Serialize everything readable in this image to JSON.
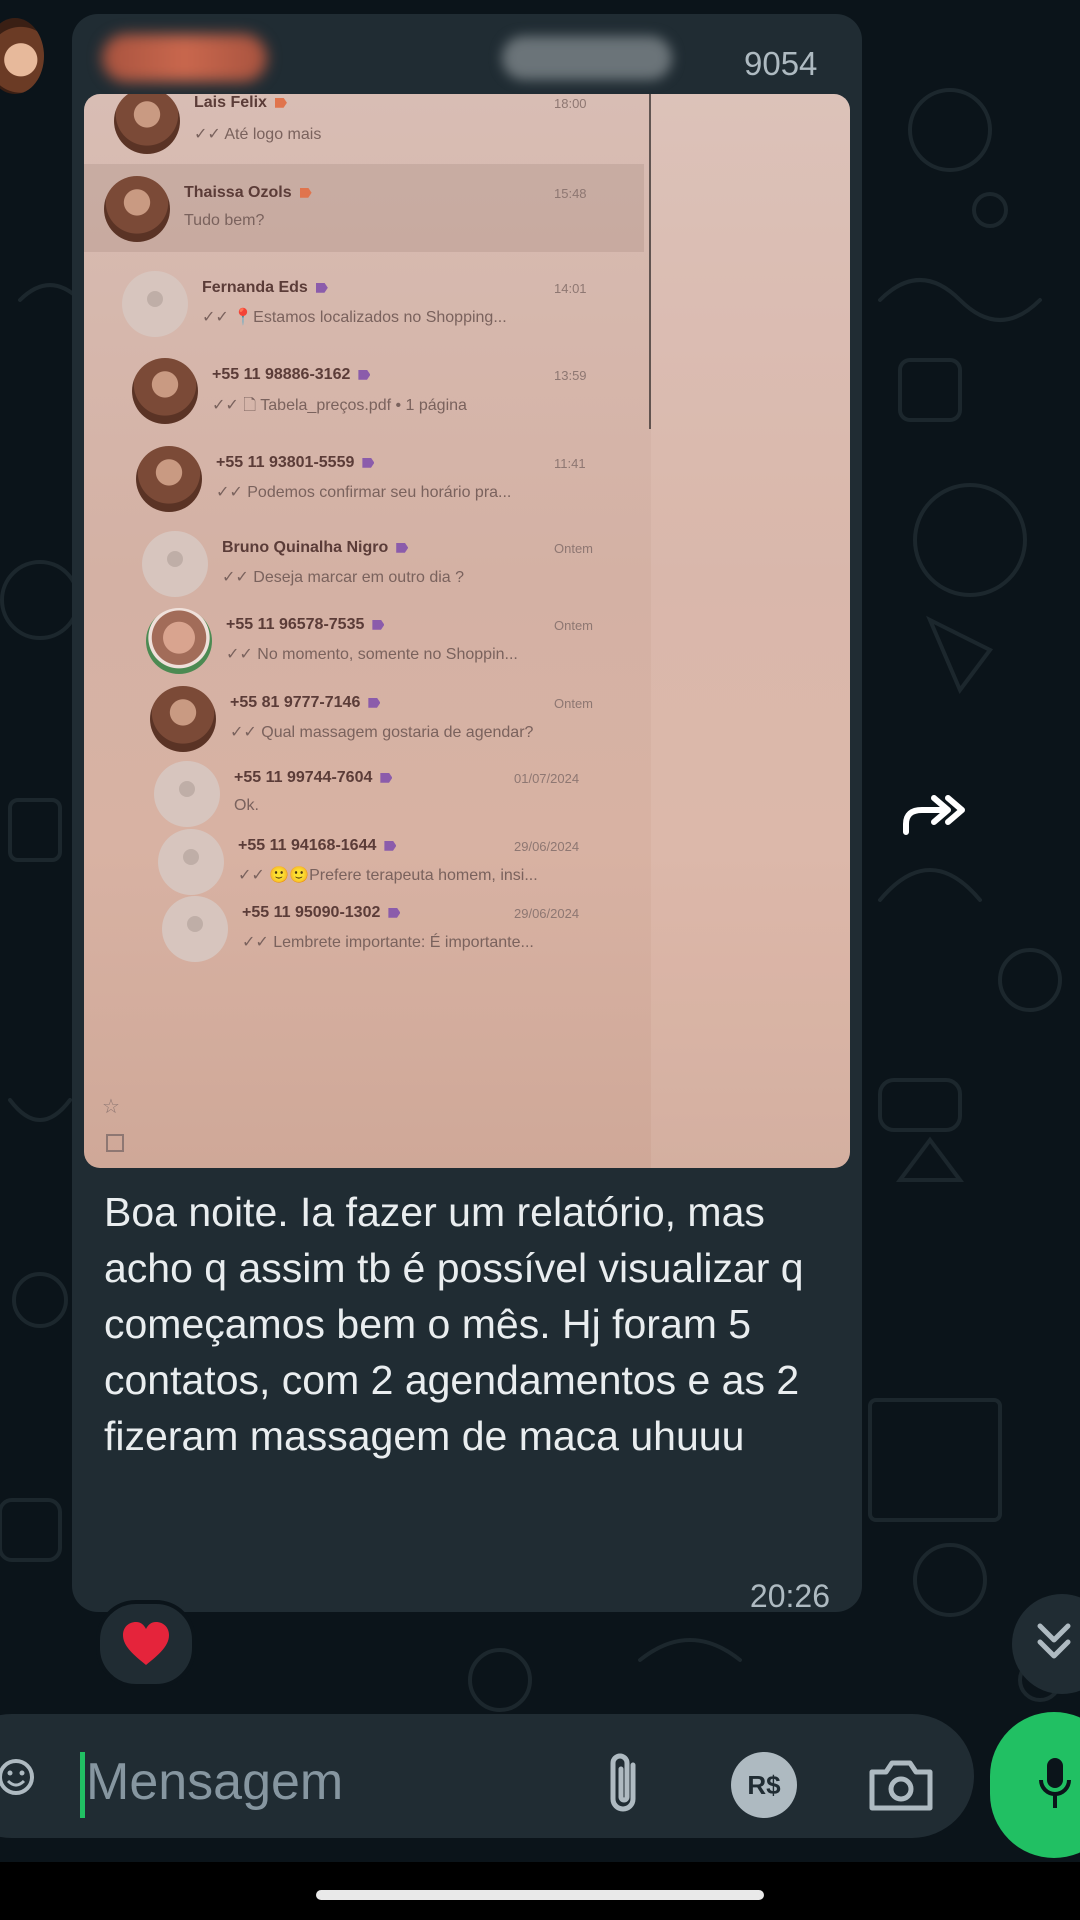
{
  "message": {
    "sender_phone_suffix": "9054",
    "caption": "Boa noite. Ia fazer um relatório, mas acho q assim tb é possível visualizar q começamos bem o mês.  Hj foram  5 contatos, com 2 agendamentos e as 2 fizeram massagem de maca uhuuu",
    "time": "20:26",
    "reaction": "❤️"
  },
  "photo": {
    "chats": [
      {
        "name": "Lais Felix",
        "time": "18:00",
        "preview": "✓✓ Até logo mais",
        "tag_color": "#e0744d",
        "avatar": "photo"
      },
      {
        "name": "Thaissa Ozols",
        "time": "15:48",
        "preview": "Tudo bem?",
        "tag_color": "#e0744d",
        "avatar": "photo",
        "highlighted": true
      },
      {
        "name": "Fernanda Eds",
        "time": "14:01",
        "preview": "✓✓ 📍Estamos localizados no Shopping...",
        "tag_color": "#8b5cab",
        "avatar": "blank"
      },
      {
        "name": "+55 11 98886-3162",
        "time": "13:59",
        "preview": "✓✓ 🗋 Tabela_preços.pdf • 1 página",
        "tag_color": "#8b5cab",
        "avatar": "photo"
      },
      {
        "name": "+55 11 93801-5559",
        "time": "11:41",
        "preview": "✓✓ Podemos confirmar seu horário pra...",
        "tag_color": "#8b5cab",
        "avatar": "photo"
      },
      {
        "name": "Bruno Quinalha Nigro",
        "time": "Ontem",
        "preview": "✓✓ Deseja marcar em outro dia ?",
        "tag_color": "#8b5cab",
        "avatar": "blank"
      },
      {
        "name": "+55 11 96578-7535",
        "time": "Ontem",
        "preview": "✓✓ No momento, somente no Shoppin...",
        "tag_color": "#8b5cab",
        "avatar": "ring"
      },
      {
        "name": "+55 81 9777-7146",
        "time": "Ontem",
        "preview": "✓✓ Qual massagem gostaria de agendar?",
        "tag_color": "#8b5cab",
        "avatar": "photo"
      },
      {
        "name": "+55 11 99744-7604",
        "time": "01/07/2024",
        "preview": "Ok.",
        "tag_color": "#8b5cab",
        "avatar": "blank"
      },
      {
        "name": "+55 11 94168-1644",
        "time": "29/06/2024",
        "preview": "✓✓ 🙂🙂Prefere terapeuta homem, insi...",
        "tag_color": "#8b5cab",
        "avatar": "blank"
      },
      {
        "name": "+55 11 95090-1302",
        "time": "29/06/2024",
        "preview": "✓✓ Lembrete importante: É importante...",
        "tag_color": "#8b5cab",
        "avatar": "blank"
      }
    ]
  },
  "composer": {
    "placeholder": "Mensagem",
    "payment_label": "R$"
  },
  "icons": {
    "forward": "forward-icon",
    "emoji": "emoji-icon",
    "attach": "paperclip-icon",
    "payment": "payment-icon",
    "camera": "camera-icon",
    "mic": "mic-icon",
    "scroll_down": "double-chevron-down-icon"
  },
  "colors": {
    "background": "#0b141a",
    "bubble": "#202c33",
    "accent_green": "#21c063",
    "text": "#e9edef",
    "muted": "#aebac1"
  }
}
